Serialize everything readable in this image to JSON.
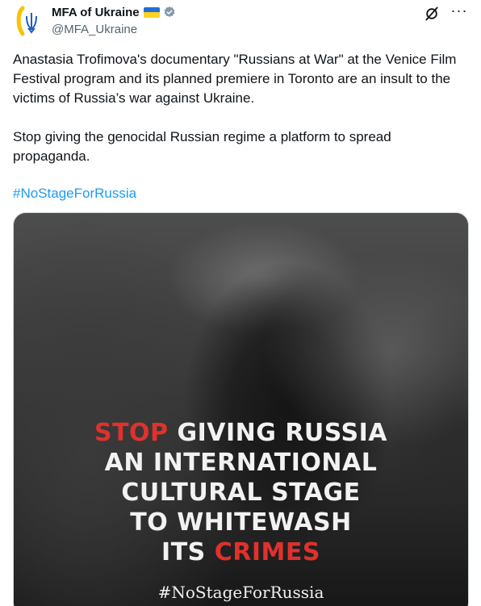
{
  "tweet": {
    "author": {
      "name": "MFA of Ukraine",
      "handle": "@MFA_Ukraine",
      "avatar_icon": "ukraine-trident-icon",
      "flag_colors": [
        "#1f6fd6",
        "#ffd21f"
      ],
      "verified_color": "#829aab"
    },
    "actions": {
      "grok_icon": "grok-icon",
      "more_label": "···"
    },
    "text": {
      "paragraph1": "Anastasia Trofimova's documentary \"Russians at War\" at the Venice Film Festival program and its planned premiere in Toronto are an insult to the victims of Russia’s war against Ukraine.",
      "paragraph2": "Stop giving the genocidal Russian regime a platform to spread propaganda.",
      "hashtag": "#NoStageForRussia"
    },
    "media": {
      "slogan": {
        "line1_red": "STOP",
        "line1_white": " GIVING RUSSIA",
        "line2": "AN INTERNATIONAL",
        "line3": "CULTURAL STAGE",
        "line4": "TO WHITEWASH",
        "line5_white": "ITS ",
        "line5_red": "CRIMES"
      },
      "hashtag": "#NoStageForRussia",
      "accent_color": "#e0312c"
    }
  }
}
